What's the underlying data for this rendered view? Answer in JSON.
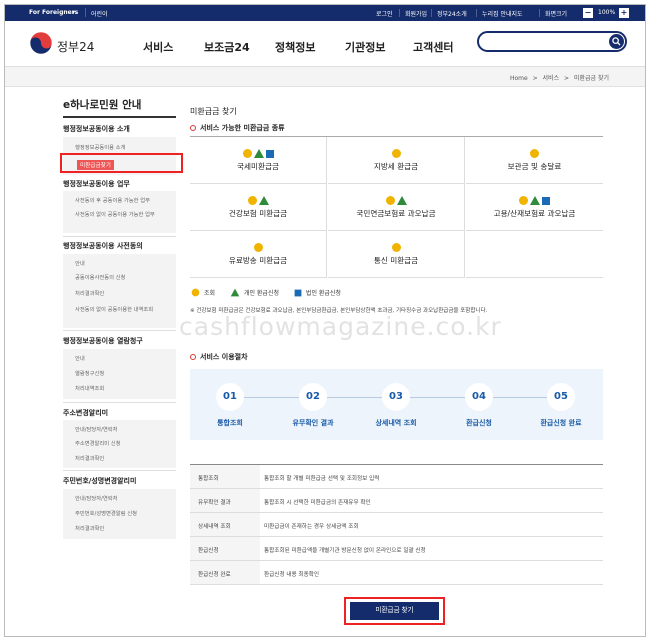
{
  "topbar": {
    "lang": "For Foreigners",
    "lang_caret": "▾",
    "lang2": "어린이",
    "links": [
      "로그인",
      "회원가입",
      "정부24소개",
      "누리집 안내지도",
      "화면크기"
    ],
    "zoom_minus": "−",
    "zoom": "100%",
    "zoom_plus": "+"
  },
  "header": {
    "logo": "정부24",
    "gnb": [
      "서비스",
      "보조금24",
      "정책정보",
      "기관정보",
      "고객센터"
    ],
    "search_placeholder": ""
  },
  "breadcrumb": [
    "Home",
    ">",
    "서비스",
    ">",
    "미환급금 찾기"
  ],
  "sidebar": {
    "title": "e하나로민원 안내",
    "groups": [
      {
        "label": "행정정보공동이용 소개",
        "items": [
          "행정정보공동이용 소개",
          "미환급금찾기"
        ]
      },
      {
        "label": "행정정보공동이용 업무",
        "items": [
          "사전동의 후 공동이용 가능한 업무",
          "사전동의 없이 공동이용 가능한 업무"
        ]
      },
      {
        "label": "행정정보공동이용 사전동의",
        "items": [
          "안내",
          "공동이용사전동의 신청",
          "처리결과확인",
          "사전동의 없이 공동이용한 내역조회"
        ]
      },
      {
        "label": "행정정보공동이용 열람청구",
        "items": [
          "안내",
          "열람청구신청",
          "처리내역조회"
        ]
      },
      {
        "label": "주소변경알리미",
        "items": [
          "안내/담당자/연락처",
          "주소변경알리미 신청",
          "처리결과확인"
        ]
      },
      {
        "label": "주민번호/성명변경알리미",
        "items": [
          "안내/담당자/연락처",
          "주민번호/성명변경알림 신청",
          "처리결과확인"
        ]
      }
    ]
  },
  "main": {
    "page_title": "미환급금 찾기",
    "types_heading": "서비스 가능한 미환급금 종류",
    "types": [
      {
        "label": "국세미환급금",
        "icons": [
          "dot",
          "tri",
          "sq"
        ]
      },
      {
        "label": "지방세 환급금",
        "icons": [
          "dot"
        ]
      },
      {
        "label": "보관금 및 송달료",
        "icons": [
          "dot"
        ]
      },
      {
        "label": "건강보험 미환급금",
        "icons": [
          "dot",
          "tri"
        ]
      },
      {
        "label": "국민연금보험료 과오납금",
        "icons": [
          "dot",
          "tri"
        ]
      },
      {
        "label": "고용/산재보험료 과오납금",
        "icons": [
          "dot",
          "tri",
          "sq"
        ]
      },
      {
        "label": "유료방송 미환급금",
        "icons": [
          "dot"
        ]
      },
      {
        "label": "통신 미환급금",
        "icons": [
          "dot"
        ]
      },
      {
        "label": "",
        "icons": []
      }
    ],
    "legend": [
      "조회",
      "개인 환급신청",
      "법인 환급신청"
    ],
    "note": "※ 건강보험 미환급금은 건강보험료 과오납금, 본인부담금환급금, 본인부담상한액 초과금, 기타징수금 과오납환급금을 포함합니다.",
    "watermark": "cashflowmagazine.co.kr",
    "process_heading": "서비스 이용절차",
    "steps": [
      {
        "num": "01",
        "label": "통합조회"
      },
      {
        "num": "02",
        "label": "유무확인 결과"
      },
      {
        "num": "03",
        "label": "상세내역 조회"
      },
      {
        "num": "04",
        "label": "환급신청"
      },
      {
        "num": "05",
        "label": "환급신청 완료"
      }
    ],
    "desc": [
      {
        "k": "통합조회",
        "v": "통합조회 할 개별 미환급금 선택 및 조회정보 입력"
      },
      {
        "k": "유무확인 결과",
        "v": "통합조회 시 선택한 미환급금의 존재유무 확인"
      },
      {
        "k": "상세내역 조회",
        "v": "미환급금이 존재하는 경우 상세금액 조회"
      },
      {
        "k": "환급신청",
        "v": "통합조회된 미환급액을 개별기관 방문신청 없이 온라인으로 일괄 신청"
      },
      {
        "k": "환급신청 완료",
        "v": "환급신청 내용 최종확인"
      }
    ],
    "cta": "미환급금 찾기"
  },
  "colors": {
    "navy": "#142c6b",
    "dot": "#f0b400",
    "tri": "#2f8a3a",
    "sq": "#1a6bb4",
    "highlight": "#e22222"
  }
}
